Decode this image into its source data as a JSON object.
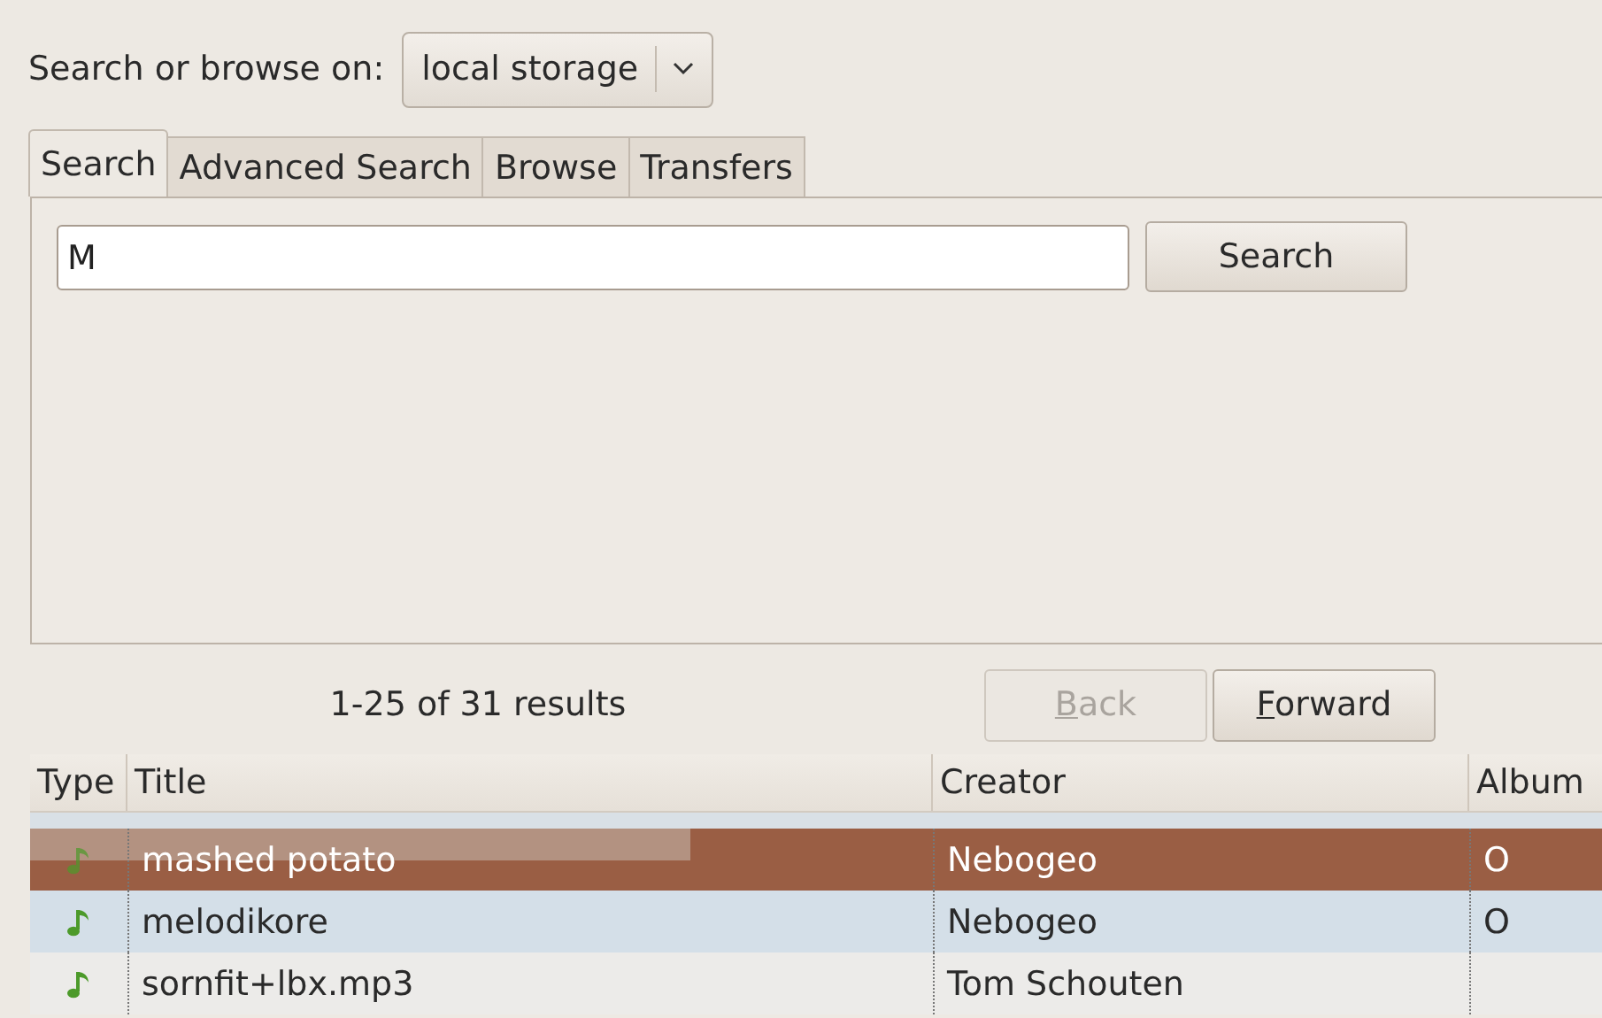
{
  "source": {
    "label": "Search or browse on:",
    "value": "local storage"
  },
  "tabs": [
    {
      "label": "Search",
      "selected": true
    },
    {
      "label": "Advanced Search",
      "selected": false
    },
    {
      "label": "Browse",
      "selected": false
    },
    {
      "label": "Transfers",
      "selected": false
    }
  ],
  "search": {
    "value": "M",
    "button": "Search"
  },
  "results": {
    "summary": "1-25 of 31 results",
    "back": {
      "label": "Back",
      "disabled": true
    },
    "forward": {
      "label": "Forward",
      "disabled": false
    }
  },
  "table": {
    "columns": [
      "Type",
      "Title",
      "Creator",
      "Album"
    ],
    "rows": [
      {
        "title": "mashed potato",
        "creator": "Nebogeo",
        "album": "O",
        "selected": true,
        "level": 0.42
      },
      {
        "title": "melodikore",
        "creator": "Nebogeo",
        "album": "O",
        "selected": false
      },
      {
        "title": "sornfit+lbx.mp3",
        "creator": "Tom Schouten",
        "album": "",
        "selected": false
      }
    ]
  }
}
